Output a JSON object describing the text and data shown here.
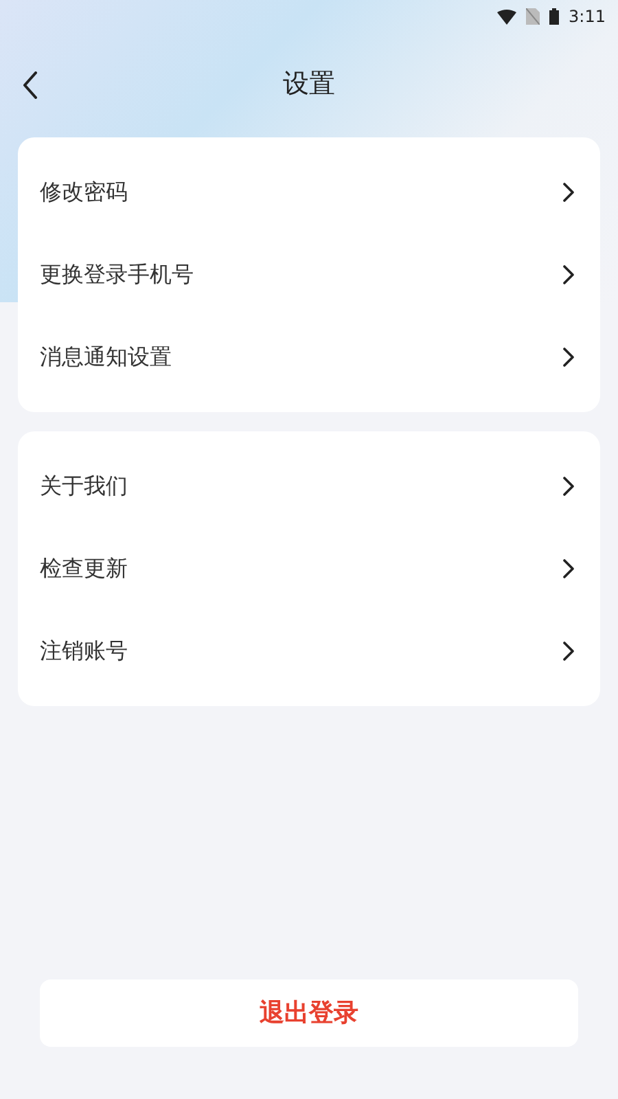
{
  "status_bar": {
    "time": "3:11"
  },
  "header": {
    "title": "设置"
  },
  "groups": [
    {
      "items": [
        {
          "label": "修改密码"
        },
        {
          "label": "更换登录手机号"
        },
        {
          "label": "消息通知设置"
        }
      ]
    },
    {
      "items": [
        {
          "label": "关于我们"
        },
        {
          "label": "检查更新"
        },
        {
          "label": "注销账号"
        }
      ]
    }
  ],
  "logout_button": {
    "label": "退出登录"
  }
}
